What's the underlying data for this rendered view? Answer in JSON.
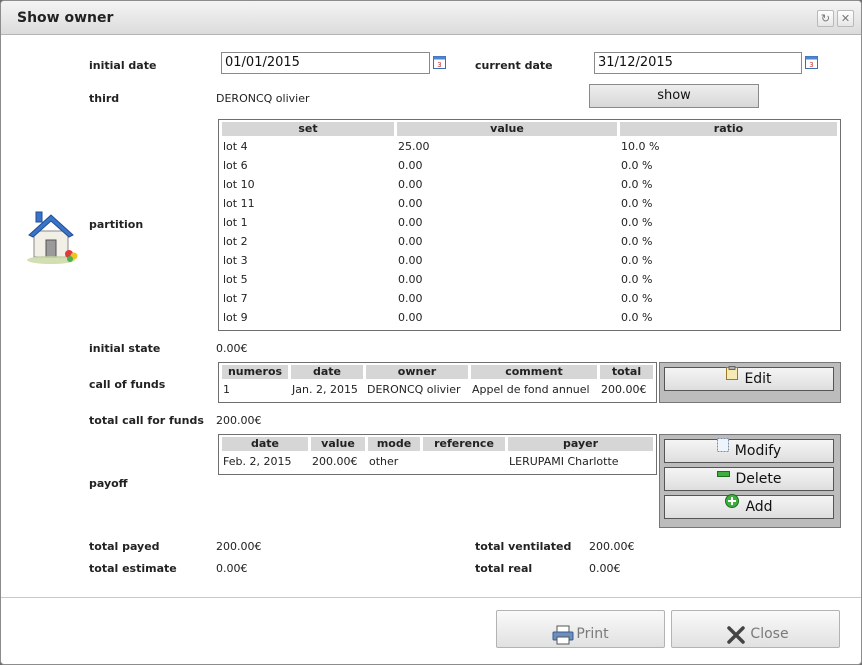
{
  "window": {
    "title": "Show owner"
  },
  "header": {
    "initial_date_label": "initial date",
    "initial_date_value": "01/01/2015",
    "current_date_label": "current date",
    "current_date_value": "31/12/2015",
    "third_label": "third",
    "third_value": "DERONCQ olivier",
    "show_button": "show"
  },
  "partition": {
    "label": "partition",
    "columns": [
      "set",
      "value",
      "ratio"
    ],
    "rows": [
      [
        "lot 4",
        "25.00",
        "10.0 %"
      ],
      [
        "lot 6",
        "0.00",
        "0.0 %"
      ],
      [
        "lot 10",
        "0.00",
        "0.0 %"
      ],
      [
        "lot 11",
        "0.00",
        "0.0 %"
      ],
      [
        "lot 1",
        "0.00",
        "0.0 %"
      ],
      [
        "lot 2",
        "0.00",
        "0.0 %"
      ],
      [
        "lot 3",
        "0.00",
        "0.0 %"
      ],
      [
        "lot 5",
        "0.00",
        "0.0 %"
      ],
      [
        "lot 7",
        "0.00",
        "0.0 %"
      ],
      [
        "lot 9",
        "0.00",
        "0.0 %"
      ]
    ]
  },
  "initial_state": {
    "label": "initial state",
    "value": "0.00€"
  },
  "call_of_funds": {
    "label": "call of funds",
    "columns": [
      "numeros",
      "date",
      "owner",
      "comment",
      "total"
    ],
    "rows": [
      [
        "1",
        "Jan. 2, 2015",
        "DERONCQ olivier",
        "Appel de fond annuel",
        "200.00€"
      ]
    ],
    "edit_button": "Edit"
  },
  "total_call_for_funds": {
    "label": "total call for funds",
    "value": "200.00€"
  },
  "payoff": {
    "label": "payoff",
    "columns": [
      "date",
      "value",
      "mode",
      "reference",
      "payer"
    ],
    "rows": [
      [
        "Feb. 2, 2015",
        "200.00€",
        "other",
        "",
        "LERUPAMI Charlotte"
      ]
    ],
    "modify_button": "Modify",
    "delete_button": "Delete",
    "add_button": "Add"
  },
  "totals": {
    "total_payed_label": "total payed",
    "total_payed_value": "200.00€",
    "total_ventilated_label": "total ventilated",
    "total_ventilated_value": "200.00€",
    "total_estimate_label": "total estimate",
    "total_estimate_value": "0.00€",
    "total_real_label": "total real",
    "total_real_value": "0.00€"
  },
  "footer": {
    "print_button": "Print",
    "close_button": "Close"
  },
  "icons": {
    "owner_image": "house-icon",
    "calendar": "calendar-icon",
    "edit": "edit-icon",
    "modify": "modify-icon",
    "delete": "delete-icon",
    "add": "add-icon",
    "print": "printer-icon",
    "close": "close-icon"
  },
  "colors": {
    "table_header": "#d6d6d6",
    "button_panel": "#bcbcbc",
    "house_roof": "#3a74c9"
  }
}
